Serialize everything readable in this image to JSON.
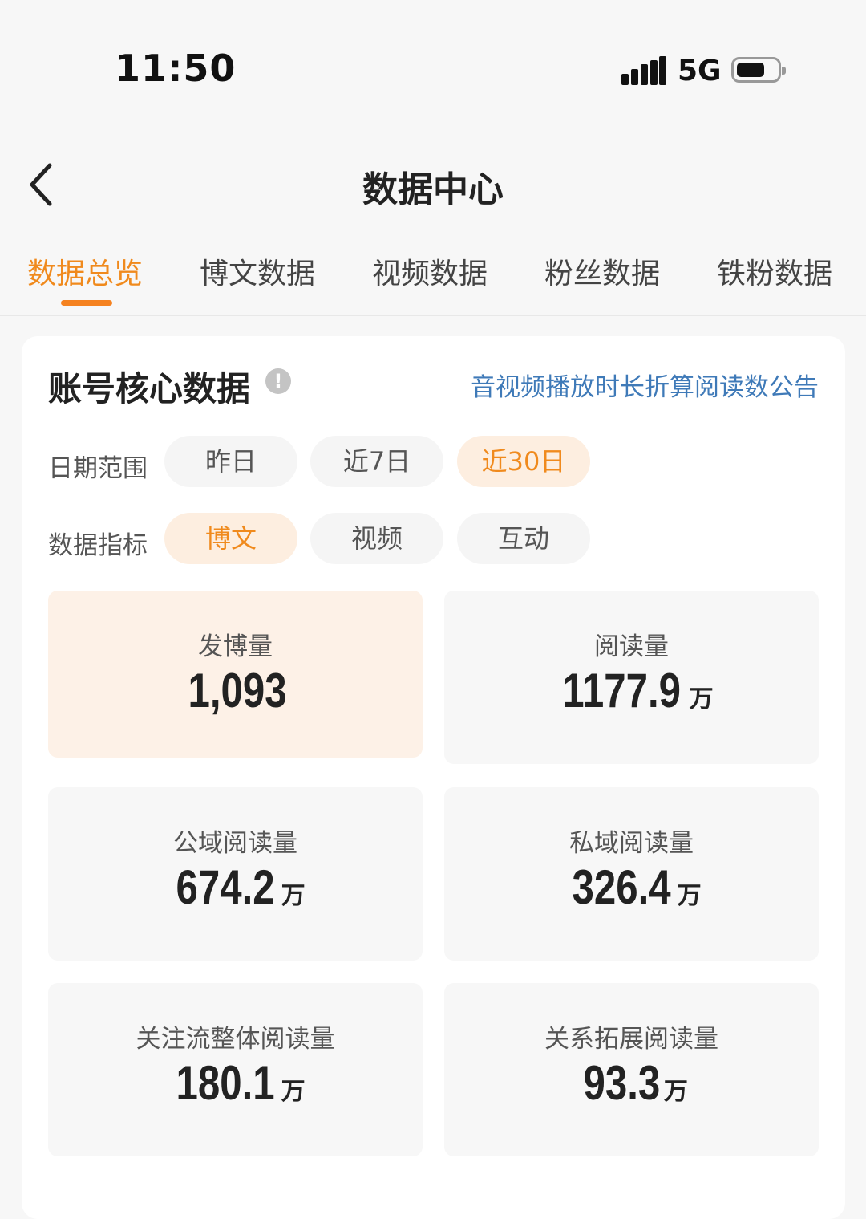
{
  "status_bar": {
    "time": "11:50",
    "network": "5G",
    "icons": [
      "signal-icon",
      "battery-icon"
    ]
  },
  "nav": {
    "title": "数据中心",
    "back_icon": "chevron-left-icon"
  },
  "tabs": [
    {
      "label": "数据总览",
      "active": true
    },
    {
      "label": "博文数据",
      "active": false
    },
    {
      "label": "视频数据",
      "active": false
    },
    {
      "label": "粉丝数据",
      "active": false
    },
    {
      "label": "铁粉数据",
      "active": false
    }
  ],
  "core_card": {
    "title": "账号核心数据",
    "info_icon": "info-icon",
    "notice_link": "音视频播放时长折算阅读数公告",
    "date_range": {
      "label": "日期范围",
      "options": [
        "昨日",
        "近7日",
        "近30日"
      ],
      "selected": "近30日"
    },
    "metric_type": {
      "label": "数据指标",
      "options": [
        "博文",
        "视频",
        "互动"
      ],
      "selected": "博文"
    },
    "metrics": [
      {
        "label": "发博量",
        "value": "1,093",
        "unit": "",
        "selected": true
      },
      {
        "label": "阅读量",
        "value": "1177.9",
        "unit": "万",
        "selected": false
      },
      {
        "label": "公域阅读量",
        "value": "674.2",
        "unit": "万",
        "selected": false
      },
      {
        "label": "私域阅读量",
        "value": "326.4",
        "unit": "万",
        "selected": false
      },
      {
        "label": "关注流整体阅读量",
        "value": "180.1",
        "unit": "万",
        "selected": false
      },
      {
        "label": "关系拓展阅读量",
        "value": "93.3",
        "unit": "万",
        "selected": false
      }
    ]
  },
  "colors": {
    "accent": "#f58220",
    "link": "#3f7ab8",
    "selected_bg": "#fdeee0"
  }
}
